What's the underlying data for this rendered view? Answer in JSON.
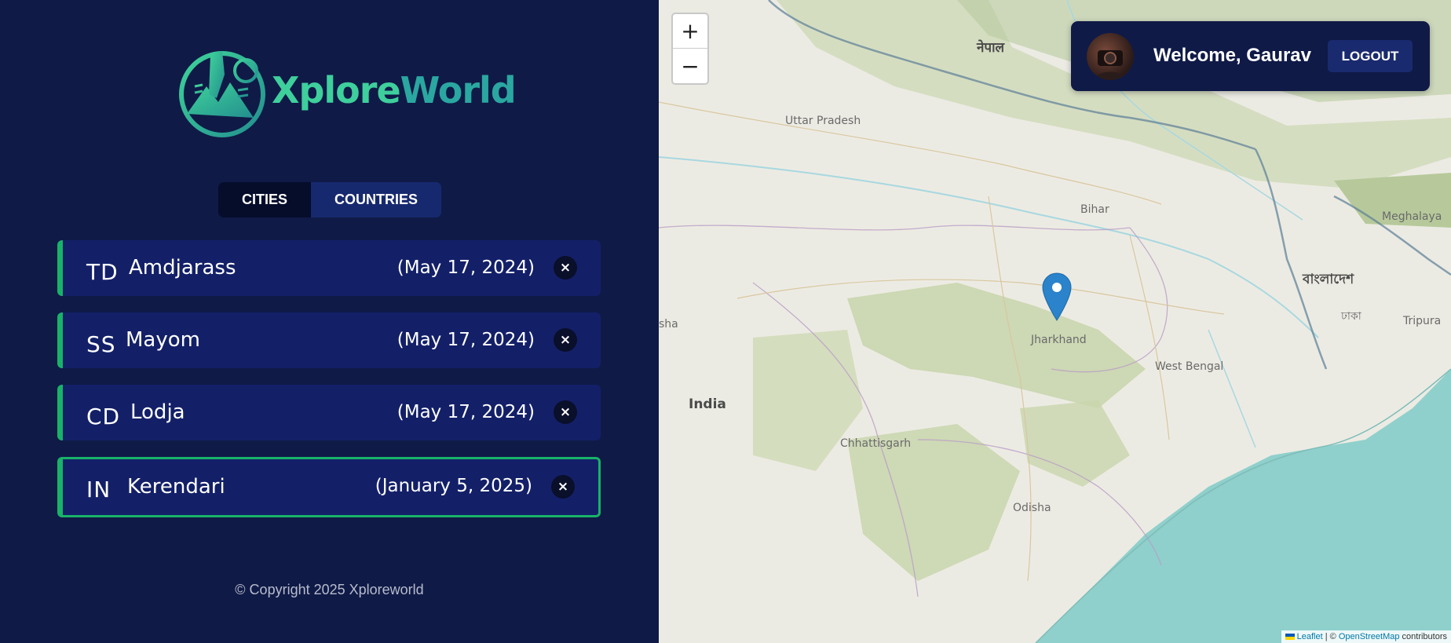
{
  "brand": {
    "name": "XploreWorld",
    "name_part1": "Xplore",
    "name_part2": "World"
  },
  "tabs": [
    {
      "label": "CITIES",
      "active": true
    },
    {
      "label": "COUNTRIES",
      "active": false
    }
  ],
  "cities": [
    {
      "code": "TD",
      "name": "Amdjarass",
      "date": "(May 17, 2024)",
      "selected": false
    },
    {
      "code": "SS",
      "name": "Mayom",
      "date": "(May 17, 2024)",
      "selected": false
    },
    {
      "code": "CD",
      "name": "Lodja",
      "date": "(May 17, 2024)",
      "selected": false
    },
    {
      "code": "IN",
      "name": "Kerendari",
      "date": "(January 5, 2025)",
      "selected": true
    }
  ],
  "delete_glyph": "×",
  "footer": {
    "copyright": "© Copyright 2025 Xploreworld"
  },
  "map": {
    "zoom_in": "+",
    "zoom_out": "−",
    "labels": {
      "nepal": "नेपाल",
      "uttar_pradesh": "Uttar Pradesh",
      "bihar": "Bihar",
      "jharkhand": "Jharkhand",
      "west_bengal": "West Bengal",
      "india": "India",
      "chhattisgarh": "Chhattisgarh",
      "odisha": "Odisha",
      "meghalaya": "Meghalaya",
      "tripura": "Tripura",
      "bangladesh": "বাংলাদেশ",
      "dhaka": "ঢাকা",
      "sha": "sha"
    },
    "attribution": {
      "leaflet": "Leaflet",
      "separator": " | © ",
      "osm": "OpenStreetMap",
      "contributors": " contributors"
    },
    "colors": {
      "sea": "#8fd0cc",
      "land": "#ecebe3",
      "forest": "#b4c99a",
      "marker": "#2a83cb"
    }
  },
  "user": {
    "welcome": "Welcome, Gaurav",
    "logout_label": "LOGOUT"
  }
}
